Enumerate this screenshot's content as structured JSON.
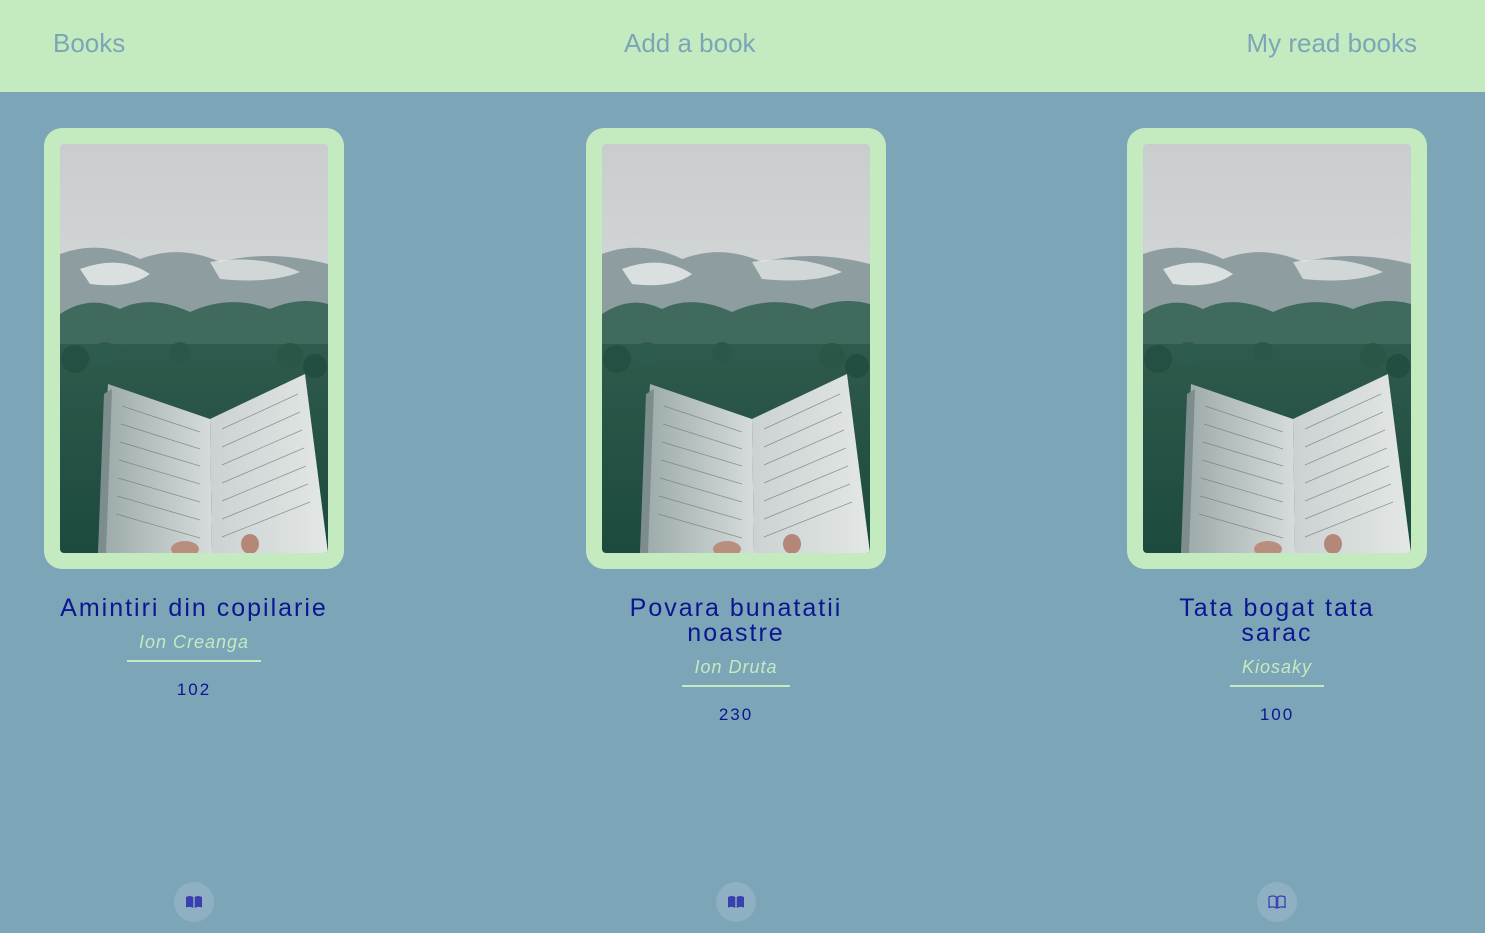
{
  "nav": {
    "books": "Books",
    "add_book": "Add a book",
    "my_read_books": "My read books"
  },
  "books": [
    {
      "title": "Amintiri din copilarie",
      "author": "Ion Creanga",
      "pages": "102",
      "read_icon": "open-book-filled-icon"
    },
    {
      "title": "Povara bunatatii noastre",
      "author": "Ion Druta",
      "pages": "230",
      "read_icon": "open-book-filled-icon"
    },
    {
      "title": "Tata bogat tata sarac",
      "author": "Kiosaky",
      "pages": "100",
      "read_icon": "open-book-outline-icon"
    }
  ],
  "colors": {
    "background": "#7ca5b8",
    "navbar": "#c4ebc0",
    "title_text": "#0d1590",
    "icon": "#3a3fb0"
  }
}
